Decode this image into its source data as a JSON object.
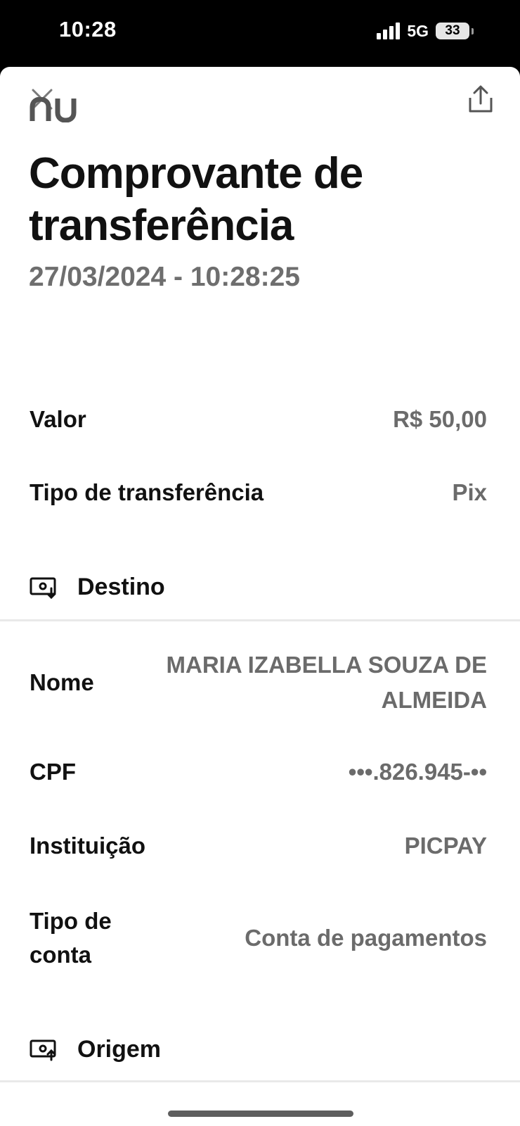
{
  "status_bar": {
    "time": "10:28",
    "network": "5G",
    "battery": "33"
  },
  "header": {
    "close_icon": "close-icon",
    "share_icon": "share-icon"
  },
  "brand": {
    "logo_text": "nu"
  },
  "receipt": {
    "title": "Comprovante de transferência",
    "datetime": "27/03/2024 - 10:28:25",
    "fields": [
      {
        "label": "Valor",
        "value": "R$ 50,00"
      },
      {
        "label": "Tipo de transferência",
        "value": "Pix"
      }
    ]
  },
  "destino": {
    "title": "Destino",
    "icon": "money-in-icon",
    "fields": [
      {
        "label": "Nome",
        "value": "MARIA IZABELLA SOUZA DE ALMEIDA"
      },
      {
        "label": "CPF",
        "value": "•••.826.945-••"
      },
      {
        "label": "Instituição",
        "value": "PICPAY"
      },
      {
        "label": "Tipo de conta",
        "value": "Conta de pagamentos"
      }
    ]
  },
  "origem": {
    "title": "Origem",
    "icon": "money-out-icon"
  },
  "colors": {
    "text_primary": "#111111",
    "text_secondary": "#6b6b6b",
    "background": "#ffffff",
    "status_bar": "#000000"
  }
}
